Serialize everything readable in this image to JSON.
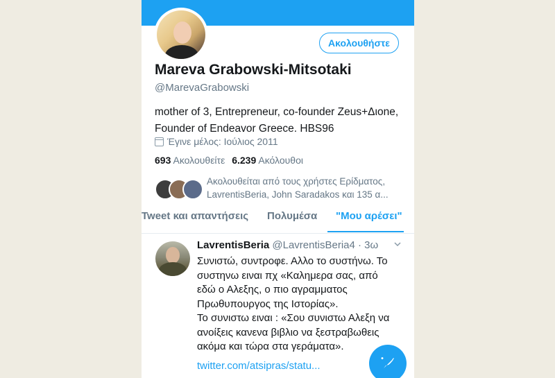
{
  "profile": {
    "name": "Mareva Grabowski-Mitsotaki",
    "handle": "@MarevaGrabowski",
    "bio_lines": [
      "mother of 3, Entrepreneur, co-founder Zeus+Διone,",
      "Founder of Endeavor Greece. HBS96"
    ],
    "joined": "Έγινε μέλος: Ιούλιος 2011",
    "following_count": "693",
    "following_label": "Ακολουθείτε",
    "followers_count": "6.239",
    "followers_label": "Ακόλουθοι",
    "followed_by_lines": [
      "Ακολουθείται από τους χρήστες Ερίδματος,",
      "LavrentisBeria, John Saradakos και 135 α..."
    ],
    "follow_button": "Ακολουθήστε"
  },
  "tabs": [
    {
      "label": "Tweet και απαντήσεις"
    },
    {
      "label": "Πολυμέσα"
    },
    {
      "label": "\"Μου αρέσει\""
    }
  ],
  "tweet": {
    "author_name": "LavrentisBeria",
    "author_handle": "@LavrentisBeria4",
    "time": "· 3ω",
    "lines": [
      "Συνιστώ, συντροφε. Αλλο το συστήνω. Το",
      "συστηνω ειναι πχ «Καλημερα σας, από",
      "εδώ ο Αλεξης, ο πιο αγραμματος",
      "Πρωθυπουργος της Ιστορίας».",
      "Το συνιστω ειναι : «Σου συνιστω Αλεξη να",
      "ανοίξεις κανενα βιβλιο να ξεστραβωθεις",
      "ακόμα και τώρα στα γεράματα»."
    ],
    "link": "twitter.com/atsipras/statu..."
  },
  "colors": {
    "accent": "#1da1f2",
    "text": "#14171a",
    "secondary": "#657786",
    "background": "#efece2"
  },
  "icons": {
    "calendar": "calendar-icon",
    "chevron": "chevron-down-icon",
    "compose": "compose-tweet-icon"
  }
}
